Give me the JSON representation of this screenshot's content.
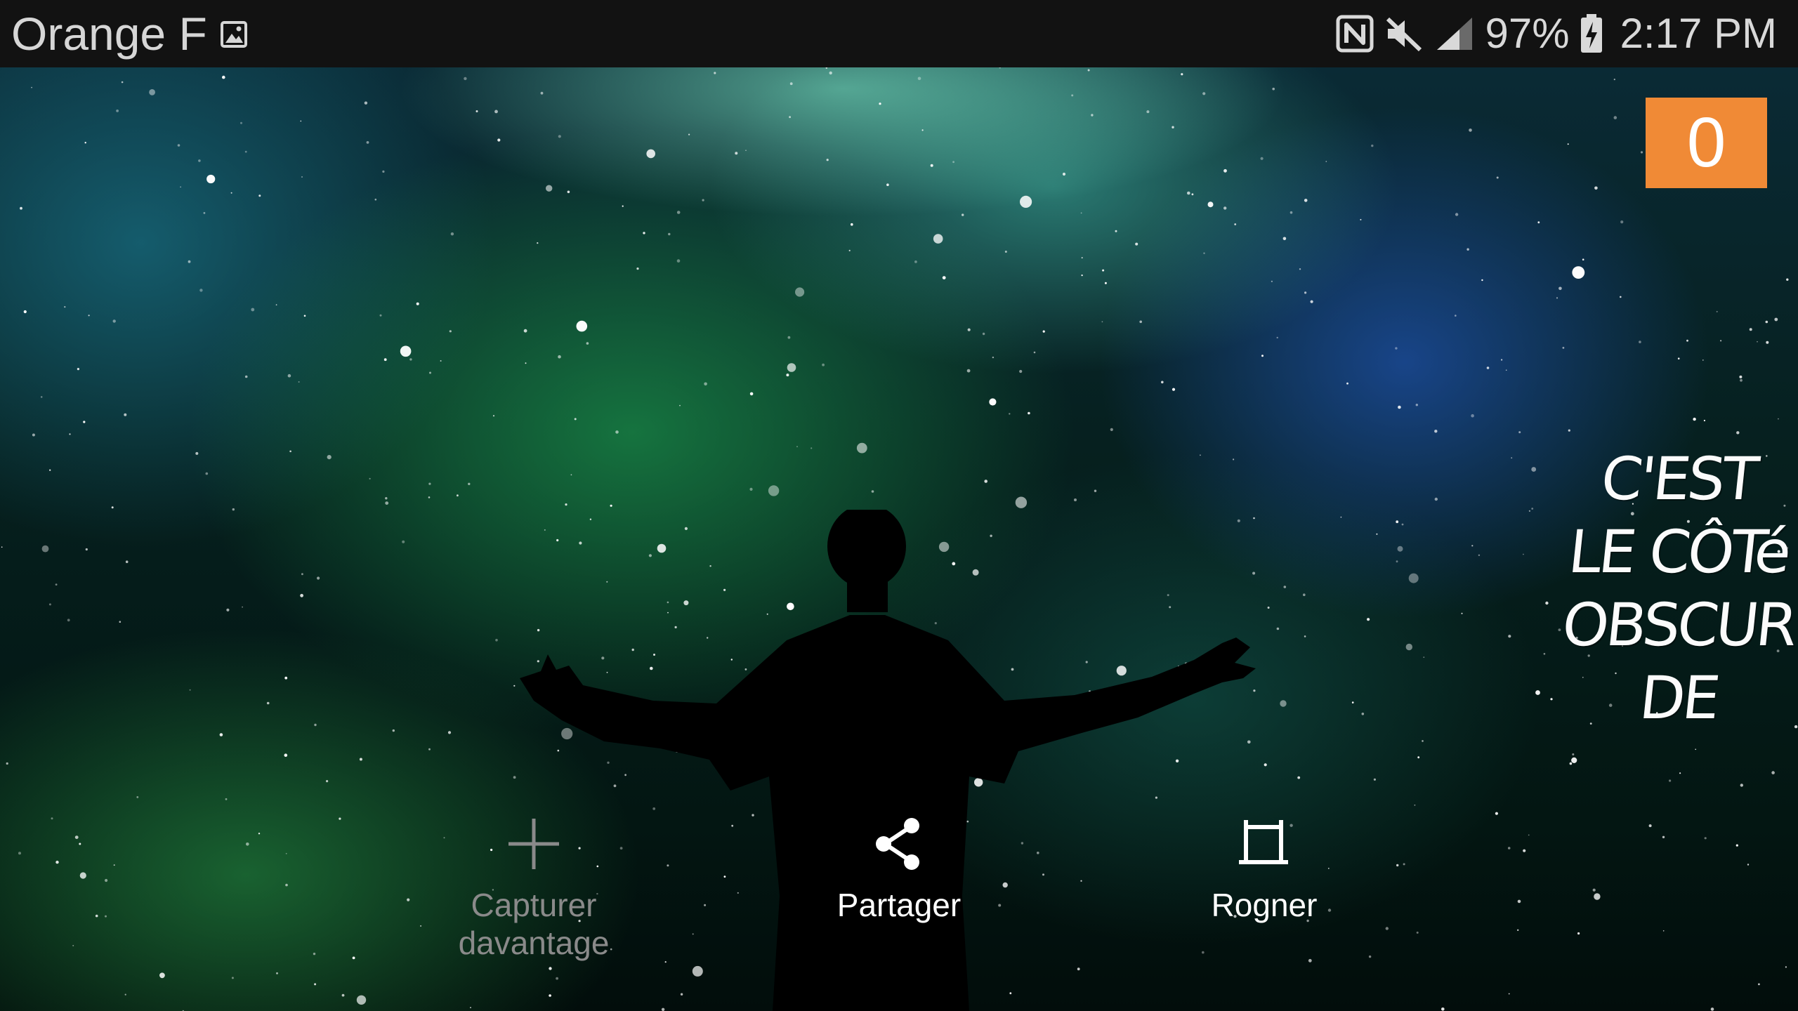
{
  "status_bar": {
    "carrier": "Orange F",
    "notification_icon": "gallery-image-icon",
    "icons": [
      "nfc-icon",
      "mute-icon",
      "signal-icon",
      "battery-charging-icon"
    ],
    "battery": "97%",
    "time": "2:17 PM"
  },
  "wallpaper": {
    "subject": "silhouette-arms-open-icon"
  },
  "counter": {
    "value": "0",
    "color": "#f08a36"
  },
  "quote": {
    "lines": [
      "C'EST",
      "LE CÔTé",
      "OBSCUR",
      "DE"
    ]
  },
  "actions": [
    {
      "label": "Capturer\ndavantage",
      "icon": "plus-icon",
      "enabled": false
    },
    {
      "label": "Partager",
      "icon": "share-icon",
      "enabled": true
    },
    {
      "label": "Rogner",
      "icon": "crop-icon",
      "enabled": true
    }
  ]
}
